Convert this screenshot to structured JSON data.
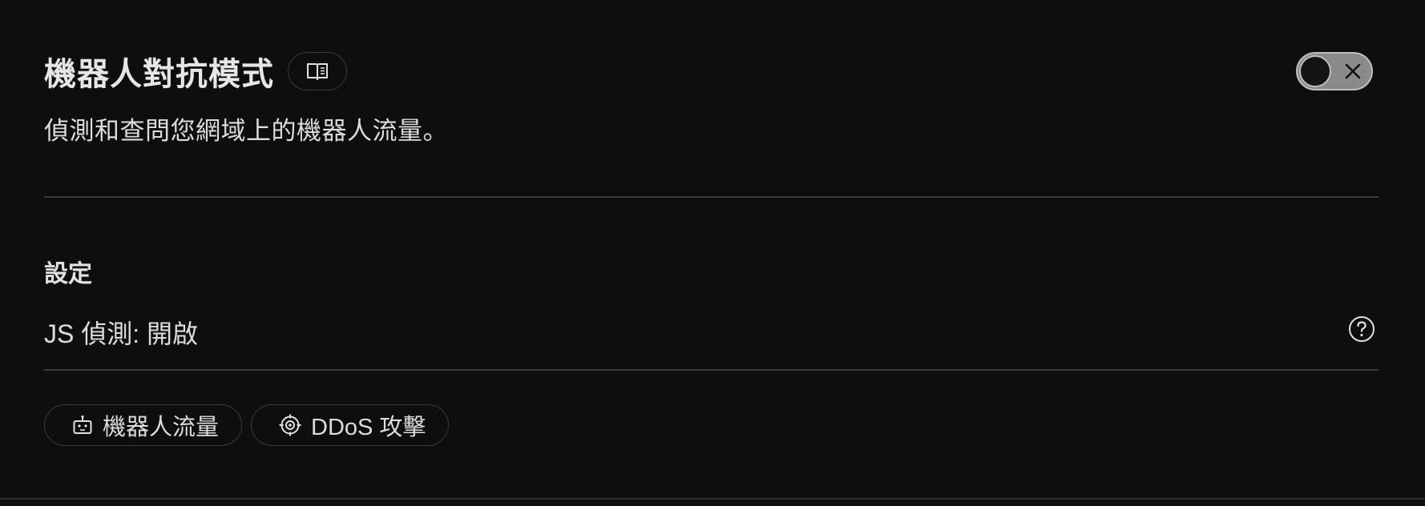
{
  "header": {
    "title": "機器人對抗模式",
    "docs_icon": "book-icon"
  },
  "toggle": {
    "state": "off",
    "icon": "close-icon"
  },
  "description": "偵測和查問您網域上的機器人流量。",
  "settings": {
    "title": "設定",
    "js_detection": "JS 偵測: 開啟",
    "help_icon": "question-circle-icon"
  },
  "chips": [
    {
      "label": "機器人流量",
      "icon": "robot-icon"
    },
    {
      "label": "DDoS 攻擊",
      "icon": "target-icon"
    }
  ],
  "colors": {
    "background": "#0e0e0e",
    "text": "#e6e6e6",
    "border": "#3a3a3a",
    "toggle_track": "#8a8a8a"
  }
}
